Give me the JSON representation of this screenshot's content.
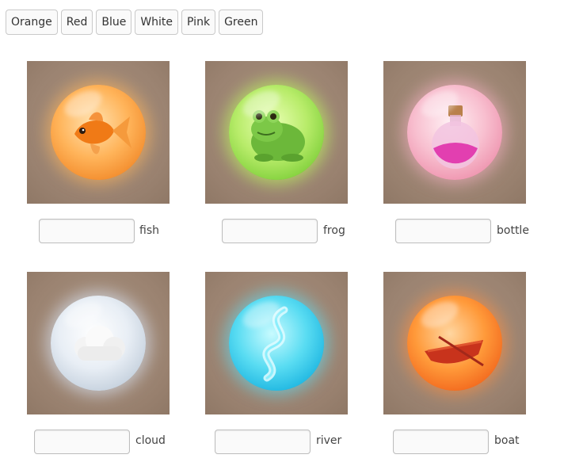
{
  "word_bank": [
    "Orange",
    "Red",
    "Blue",
    "White",
    "Pink",
    "Green"
  ],
  "items": [
    {
      "icon": "goldfish-orb",
      "label": "fish",
      "answer": ""
    },
    {
      "icon": "frog-orb",
      "label": "frog",
      "answer": ""
    },
    {
      "icon": "potion-bottle-orb",
      "label": "bottle",
      "answer": ""
    },
    {
      "icon": "cloud-orb",
      "label": "cloud",
      "answer": ""
    },
    {
      "icon": "river-orb",
      "label": "river",
      "answer": ""
    },
    {
      "icon": "rowboat-orb",
      "label": "boat",
      "answer": ""
    }
  ]
}
